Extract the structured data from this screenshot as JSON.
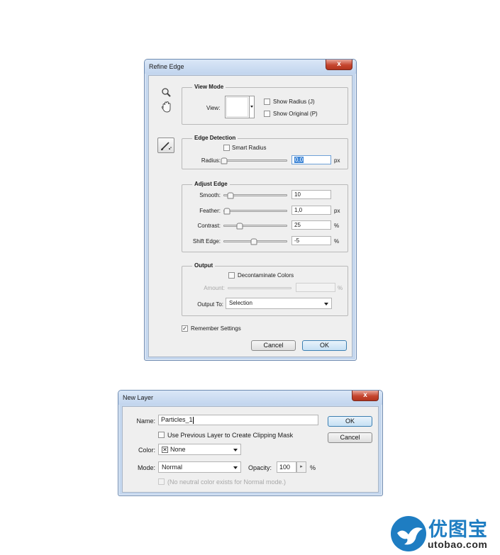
{
  "refine_edge": {
    "title": "Refine Edge",
    "close_glyph": "x",
    "view_mode": {
      "title": "View Mode",
      "view_label": "View:",
      "show_radius_label": "Show Radius (J)",
      "show_radius_checked": false,
      "show_original_label": "Show Original (P)",
      "show_original_checked": false
    },
    "edge_detection": {
      "title": "Edge Detection",
      "smart_radius_label": "Smart Radius",
      "smart_radius_checked": false,
      "radius_label": "Radius:",
      "radius_value": "0,0",
      "radius_unit": "px",
      "radius_slider_fraction": 0.0
    },
    "adjust_edge": {
      "title": "Adjust Edge",
      "smooth_label": "Smooth:",
      "smooth_value": "10",
      "smooth_slider_fraction": 0.1,
      "feather_label": "Feather:",
      "feather_value": "1,0",
      "feather_unit": "px",
      "feather_slider_fraction": 0.04,
      "contrast_label": "Contrast:",
      "contrast_value": "25",
      "contrast_unit": "%",
      "contrast_slider_fraction": 0.25,
      "shift_edge_label": "Shift Edge:",
      "shift_edge_value": "-5",
      "shift_edge_unit": "%",
      "shift_edge_slider_fraction": 0.475
    },
    "output": {
      "title": "Output",
      "decontaminate_label": "Decontaminate Colors",
      "decontaminate_checked": false,
      "amount_label": "Amount:",
      "amount_value": "",
      "amount_unit": "%",
      "output_to_label": "Output To:",
      "output_to_value": "Selection"
    },
    "remember_settings_label": "Remember Settings",
    "remember_settings_checked": true,
    "checked_glyph": "✓",
    "cancel_label": "Cancel",
    "ok_label": "OK",
    "tool_icons": [
      "zoom-tool-icon",
      "hand-tool-icon",
      "refine-radius-brush-icon"
    ]
  },
  "new_layer": {
    "title": "New Layer",
    "close_glyph": "x",
    "name_label": "Name:",
    "name_value": "Particles_1",
    "clipping_mask_label": "Use Previous Layer to Create Clipping Mask",
    "clipping_mask_checked": false,
    "color_label": "Color:",
    "color_value": "None",
    "color_swatch_glyph": "✕",
    "mode_label": "Mode:",
    "mode_value": "Normal",
    "opacity_label": "Opacity:",
    "opacity_value": "100",
    "opacity_unit": "%",
    "opacity_stepper_glyph": "▸",
    "neutral_label": "(No neutral color exists for Normal mode.)",
    "ok_label": "OK",
    "cancel_label": "Cancel"
  },
  "watermark": {
    "cn_text": "优图宝",
    "url_text": "utobao.com",
    "brand_color": "#1e7dc2"
  },
  "colors": {
    "window_frame": "#c5d7ee",
    "dialog_bg": "#efefef",
    "close_button": "#c6462f",
    "selection_highlight": "#3d85d6"
  }
}
